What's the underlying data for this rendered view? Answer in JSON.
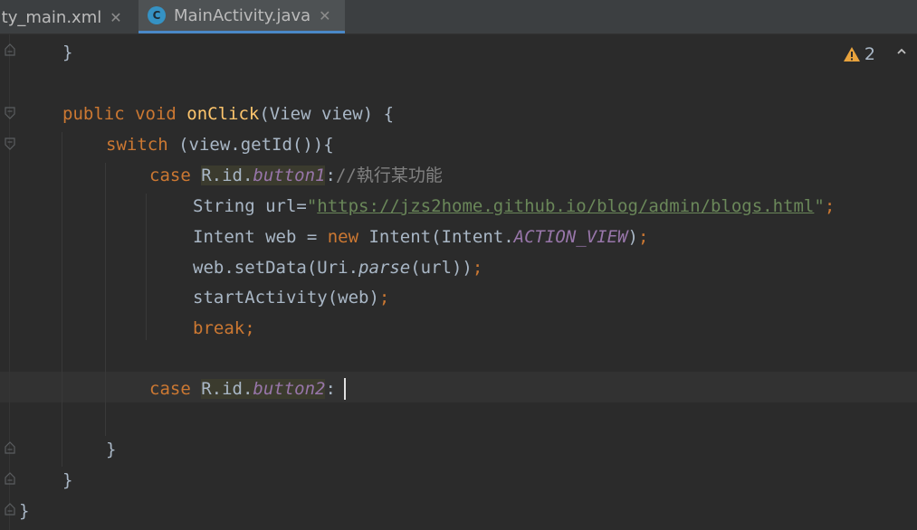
{
  "tabs": [
    {
      "label": "vity_main.xml",
      "active": false
    },
    {
      "label": "MainActivity.java",
      "active": true,
      "icon_letter": "C"
    }
  ],
  "warnings": {
    "count": "2"
  },
  "code": {
    "l1": "}",
    "l3_kw": "public void ",
    "l3_fn": "onClick",
    "l3_rest": "(View view) {",
    "l4_kw": "switch",
    "l4_rest": " (view.getId()){",
    "l5_kw": "case ",
    "l5_a": "R.id.",
    "l5_b": "button1",
    "l5_c": ":",
    "l5_cmt": "//執行某功能",
    "l6_a": "String url=",
    "l6_q1": "\"",
    "l6_url": "https://jzs2home.github.io/blog/admin/blogs.html",
    "l6_q2": "\"",
    "l6_semi": ";",
    "l7_a": "Intent web = ",
    "l7_kw": "new",
    "l7_b": " Intent(Intent.",
    "l7_fld": "ACTION_VIEW",
    "l7_c": ")",
    "l7_semi": ";",
    "l8_a": "web.setData(Uri.",
    "l8_it": "parse",
    "l8_b": "(url))",
    "l8_semi": ";",
    "l9_a": "startActivity(web)",
    "l9_semi": ";",
    "l10": "break;",
    "l12_kw": "case ",
    "l12_a": "R.id.",
    "l12_b": "button2",
    "l12_c": ":",
    "l14": "}",
    "l15": "}",
    "l16": "}"
  },
  "colors": {
    "background": "#2b2b2b",
    "keyword": "#cc7832",
    "function": "#ffc66d",
    "string": "#6a8759",
    "field": "#9876aa",
    "default": "#a9b7c6",
    "tab_underline": "#4a88c7"
  },
  "icons": {
    "warning": "warning-triangle-icon",
    "navigate": "chevron-up-icon",
    "file": "java-class-icon",
    "close": "close-icon",
    "fold": "fold-marker-icon"
  }
}
